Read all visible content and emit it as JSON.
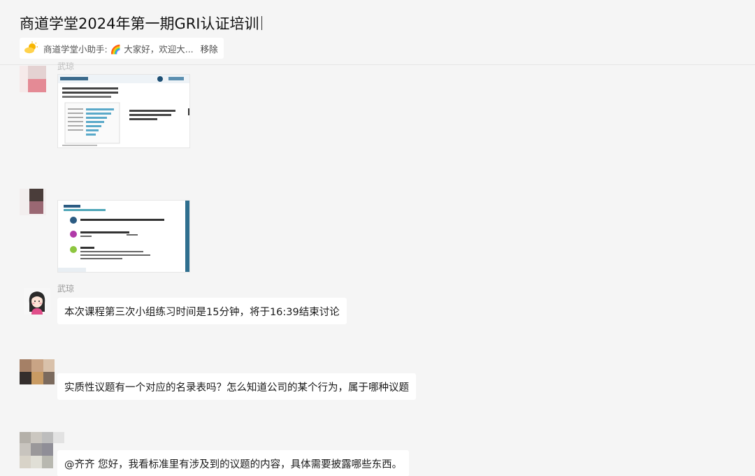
{
  "header": {
    "title": "商道学堂2024年第一期GRI认证培训",
    "pinned": {
      "text": "商道学堂小助手: 🌈 大家好，欢迎大...",
      "remove_label": "移除"
    }
  },
  "messages": [
    {
      "id": "m1",
      "sender": "武琼",
      "type": "image"
    },
    {
      "id": "m2",
      "sender": "",
      "type": "image"
    },
    {
      "id": "m3",
      "sender": "武琼",
      "type": "text",
      "text": "本次课程第三次小组练习时间是15分钟，将于16:39结束讨论"
    },
    {
      "id": "m4",
      "sender": "",
      "type": "text",
      "text": "实质性议题有一个对应的名录表吗？怎么知道公司的某个行为，属于哪种议题"
    },
    {
      "id": "m5",
      "sender": "",
      "type": "text",
      "text": "@齐齐 您好，我看标准里有涉及到的议题的内容，具体需要披露哪些东西。"
    }
  ],
  "colors": {
    "background": "#f5f5f5",
    "bubble": "#ffffff",
    "sender": "#999999"
  }
}
